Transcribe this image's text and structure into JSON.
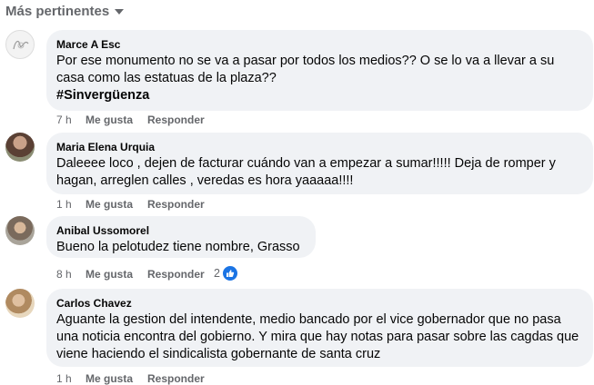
{
  "sort": {
    "label": "Más pertinentes",
    "icon": "caret-down-icon"
  },
  "comments": [
    {
      "author": "Marce A Esc",
      "text": "Por ese monumento no se va a pasar por todos los medios?? O se lo va a llevar a su casa como las estatuas de la plaza??",
      "hashtag": "#Sinvergüenza",
      "time": "7 h",
      "like": "Me gusta",
      "reply": "Responder"
    },
    {
      "author": "Maria Elena Urquia",
      "text": "Daleeee loco , dejen de facturar cuándo van a empezar a sumar!!!!! Deja de romper y hagan, arreglen calles , veredas es hora yaaaaa!!!!",
      "time": "1 h",
      "like": "Me gusta",
      "reply": "Responder"
    },
    {
      "author": "Anibal Ussomorel",
      "text": "Bueno la pelotudez tiene nombre, Grasso",
      "time": "8 h",
      "like": "Me gusta",
      "reply": "Responder",
      "reaction_count": "2"
    },
    {
      "author": "Carlos Chavez",
      "text": "Aguante la gestion del intendente, medio bancado por el vice gobernador que no pasa una noticia encontra del gobierno. Y mira que hay notas para pasar sobre las cagdas que viene haciendo el sindicalista gobernante de santa cruz",
      "time": "1 h",
      "like": "Me gusta",
      "reply": "Responder"
    }
  ],
  "colors": {
    "bubble": "#f0f2f5",
    "meta": "#65676b",
    "like_blue": "#1b74e4"
  }
}
